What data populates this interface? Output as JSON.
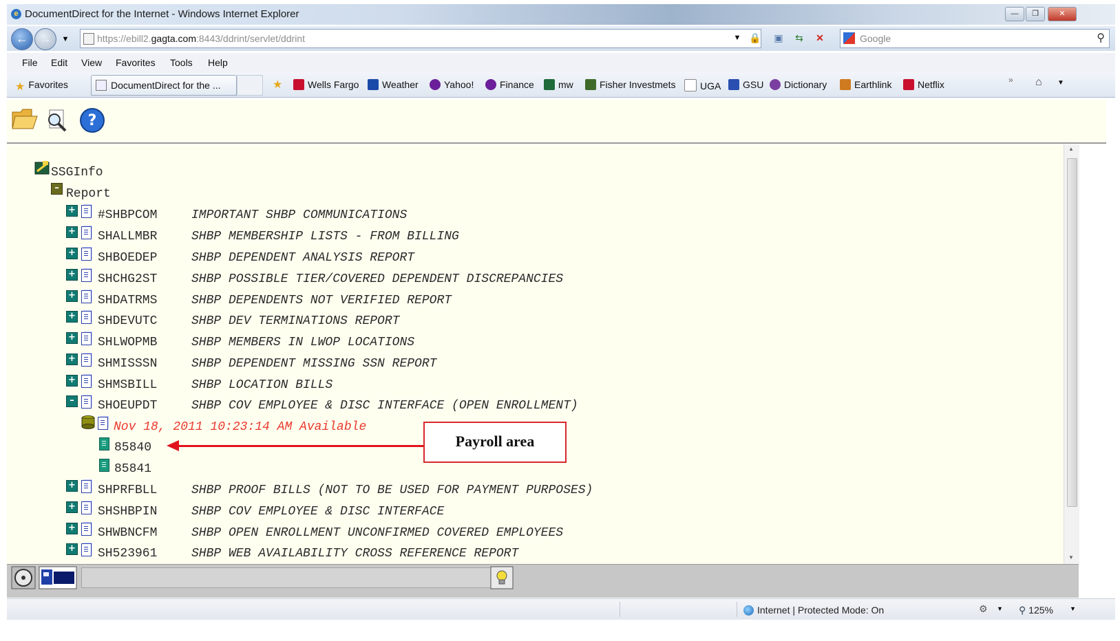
{
  "window": {
    "title": "DocumentDirect for the Internet - Windows Internet Explorer"
  },
  "address": {
    "url_scheme": "https://",
    "url_host_prefix": "ebill2.",
    "url_host": "gagta.com",
    "url_path": ":8443/ddrint/servlet/ddrint",
    "search_placeholder": "Google"
  },
  "menu": [
    "File",
    "Edit",
    "View",
    "Favorites",
    "Tools",
    "Help"
  ],
  "favorites_bar": {
    "favorites_label": "Favorites",
    "tab_label": "DocumentDirect for the ...",
    "links": [
      {
        "label": "Wells Fargo",
        "icon": "wells-fargo-icon",
        "color": "#c8102e"
      },
      {
        "label": "Weather",
        "icon": "weather-icon",
        "color": "#1a4aa8"
      },
      {
        "label": "Yahoo!",
        "icon": "yahoo-icon",
        "color": "#6b1f9a"
      },
      {
        "label": "Finance",
        "icon": "yahoo-finance-icon",
        "color": "#6b1f9a"
      },
      {
        "label": "mw",
        "icon": "mw-icon",
        "color": "#1f6b3a"
      },
      {
        "label": "Fisher Investmets",
        "icon": "fisher-investments-icon",
        "color": "#3f6b2a"
      },
      {
        "label": "UGA",
        "icon": "page-icon",
        "color": "#888888"
      },
      {
        "label": "GSU",
        "icon": "gsu-icon",
        "color": "#2a4fb0"
      },
      {
        "label": "Dictionary",
        "icon": "dictionary-icon",
        "color": "#7a3fa0"
      },
      {
        "label": "Earthlink",
        "icon": "earthlink-icon",
        "color": "#d07a20"
      },
      {
        "label": "Netflix",
        "icon": "netflix-icon",
        "color": "#c8102e"
      }
    ]
  },
  "tree": {
    "root": "SSGInfo",
    "folder": "Report",
    "reports_before": [
      {
        "code": "#SHBPCOM",
        "desc": "IMPORTANT SHBP COMMUNICATIONS"
      },
      {
        "code": "SHALLMBR",
        "desc": "SHBP MEMBERSHIP LISTS - FROM BILLING"
      },
      {
        "code": "SHBOEDEP",
        "desc": "SHBP DEPENDENT ANALYSIS REPORT"
      },
      {
        "code": "SHCHG2ST",
        "desc": "SHBP POSSIBLE TIER/COVERED DEPENDENT DISCREPANCIES"
      },
      {
        "code": "SHDATRMS",
        "desc": "SHBP DEPENDENTS NOT VERIFIED REPORT"
      },
      {
        "code": "SHDEVUTC",
        "desc": "SHBP DEV TERMINATIONS REPORT"
      },
      {
        "code": "SHLWOPMB",
        "desc": "SHBP MEMBERS IN LWOP LOCATIONS"
      },
      {
        "code": "SHMISSSN",
        "desc": "SHBP DEPENDENT MISSING SSN REPORT"
      },
      {
        "code": "SHMSBILL",
        "desc": "SHBP LOCATION BILLS"
      },
      {
        "code": "SHOEUPDT",
        "desc": "SHBP COV EMPLOYEE & DISC INTERFACE (OPEN ENROLLMENT)"
      }
    ],
    "version": "Nov 18, 2011 10:23:14 AM Available",
    "version_color": "#e83a2e",
    "sections": [
      "85840",
      "85841"
    ],
    "reports_after": [
      {
        "code": "SHPRFBLL",
        "desc": "SHBP PROOF BILLS (NOT TO BE USED FOR PAYMENT PURPOSES)"
      },
      {
        "code": "SHSHBPIN",
        "desc": "SHBP COV EMPLOYEE & DISC INTERFACE"
      },
      {
        "code": "SHWBNCFM",
        "desc": "SHBP OPEN ENROLLMENT UNCONFIRMED COVERED EMPLOYEES"
      },
      {
        "code": "SH523961",
        "desc": "SHBP WEB AVAILABILITY CROSS REFERENCE REPORT"
      }
    ]
  },
  "callout": {
    "label": "Payroll area",
    "color": "#e1141d"
  },
  "status": {
    "zone": "Internet | Protected Mode: On",
    "zoom": "125%"
  }
}
